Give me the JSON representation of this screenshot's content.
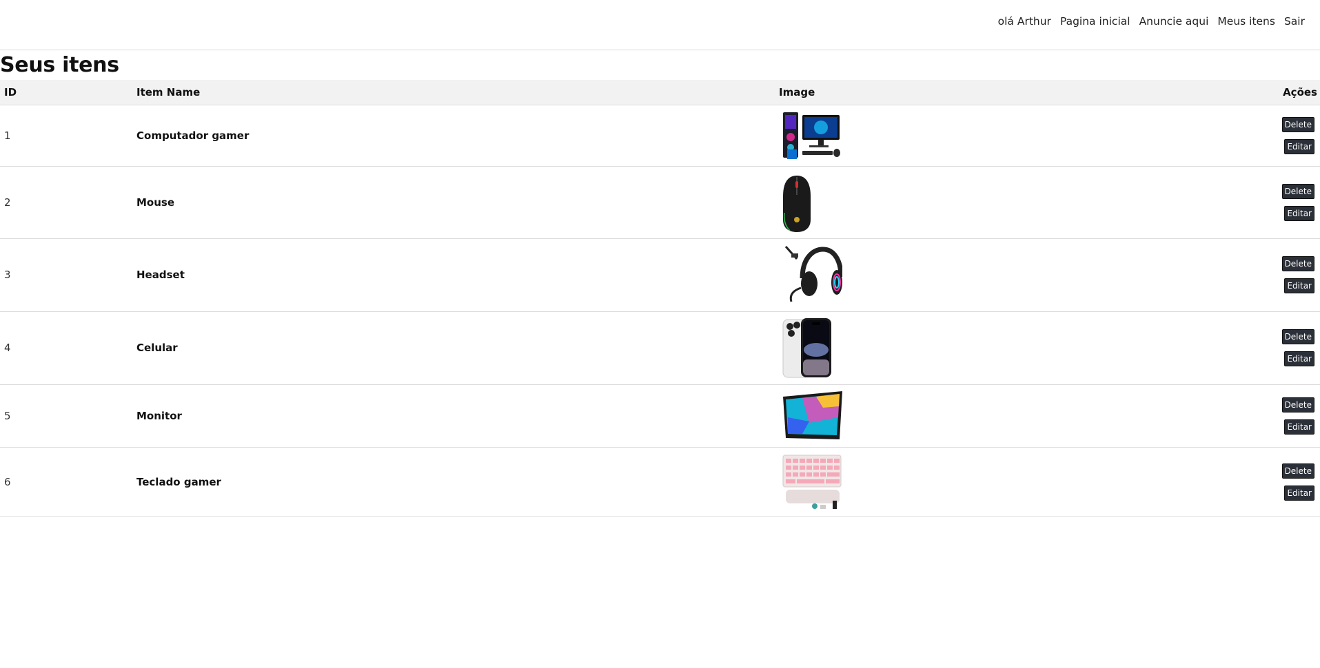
{
  "nav": {
    "greeting": "olá Arthur",
    "home": "Pagina inicial",
    "advertise": "Anuncie aqui",
    "my_items": "Meus itens",
    "logout": "Sair"
  },
  "page_title": "Seus itens",
  "table": {
    "headers": {
      "id": "ID",
      "name": "Item Name",
      "image": "Image",
      "actions": "Ações"
    },
    "delete_label": "Delete",
    "edit_label": "Editar",
    "rows": [
      {
        "id": "1",
        "name": "Computador gamer",
        "image_icon": "gaming-pc-icon"
      },
      {
        "id": "2",
        "name": "Mouse",
        "image_icon": "mouse-icon"
      },
      {
        "id": "3",
        "name": "Headset",
        "image_icon": "headset-icon"
      },
      {
        "id": "4",
        "name": "Celular",
        "image_icon": "smartphone-icon"
      },
      {
        "id": "5",
        "name": "Monitor",
        "image_icon": "monitor-icon"
      },
      {
        "id": "6",
        "name": "Teclado gamer",
        "image_icon": "keyboard-icon"
      }
    ]
  }
}
